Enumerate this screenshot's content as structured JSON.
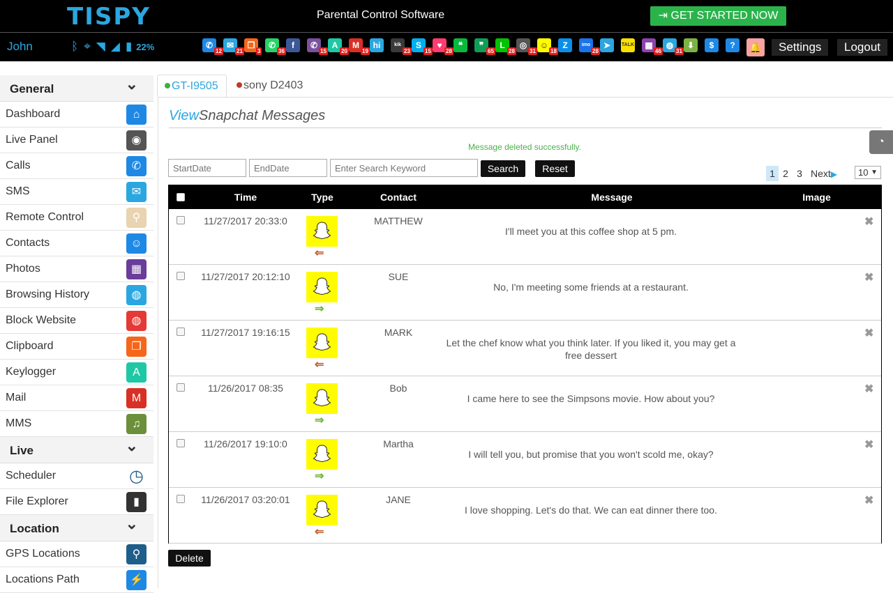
{
  "header": {
    "logo": "TISPY",
    "tagline": "Parental Control Software",
    "cta": "GET STARTED NOW",
    "cta_icon": "sign-in-icon"
  },
  "subbar": {
    "user": "John",
    "battery": "22%",
    "settings": "Settings",
    "logout": "Logout",
    "apps": [
      {
        "name": "phone",
        "glyph": "✆",
        "color": "#1e88e5",
        "badge": "12"
      },
      {
        "name": "mail",
        "glyph": "✉",
        "color": "#2aa7e0",
        "badge": "21"
      },
      {
        "name": "clipboard",
        "glyph": "❐",
        "color": "#f5661b",
        "badge": "3"
      },
      {
        "name": "whatsapp",
        "glyph": "✆",
        "color": "#25d366",
        "badge": "36"
      },
      {
        "name": "facebook",
        "glyph": "f",
        "color": "#3b5998",
        "badge": ""
      },
      {
        "name": "viber",
        "glyph": "✆",
        "color": "#7b519d",
        "badge": "15"
      },
      {
        "name": "keylogger",
        "glyph": "A",
        "color": "#1ec8a5",
        "badge": "20"
      },
      {
        "name": "gmail",
        "glyph": "M",
        "color": "#d93025",
        "badge": "19"
      },
      {
        "name": "hike",
        "glyph": "hi",
        "color": "#2aa7e0",
        "badge": ""
      },
      {
        "name": "kik",
        "glyph": "kik",
        "color": "#3a3a3a",
        "badge": "23"
      },
      {
        "name": "skype",
        "glyph": "S",
        "color": "#00aff0",
        "badge": "15"
      },
      {
        "name": "tinder",
        "glyph": "♥",
        "color": "#fe3c72",
        "badge": "28"
      },
      {
        "name": "wechat",
        "glyph": "❝",
        "color": "#09b83e",
        "badge": ""
      },
      {
        "name": "hangouts",
        "glyph": "❞",
        "color": "#0f9d58",
        "badge": "65"
      },
      {
        "name": "line",
        "glyph": "L",
        "color": "#00c300",
        "badge": "28"
      },
      {
        "name": "instagram",
        "glyph": "◎",
        "color": "#555555",
        "badge": "31"
      },
      {
        "name": "snapchat",
        "glyph": "☺",
        "color": "#fffc00",
        "badge": "18"
      },
      {
        "name": "zalo",
        "glyph": "Z",
        "color": "#0a8fe8",
        "badge": ""
      },
      {
        "name": "imo",
        "glyph": "imo",
        "color": "#1a73e8",
        "badge": "28"
      },
      {
        "name": "telegram",
        "glyph": "➤",
        "color": "#2ca5e0",
        "badge": ""
      },
      {
        "name": "kakaotalk",
        "glyph": "TALK",
        "color": "#f9e000",
        "badge": ""
      },
      {
        "name": "photos",
        "glyph": "▦",
        "color": "#8e44ad",
        "badge": "46"
      },
      {
        "name": "browser",
        "glyph": "◍",
        "color": "#2aa7e0",
        "badge": "31"
      },
      {
        "name": "download",
        "glyph": "⬇",
        "color": "#7cb342",
        "badge": ""
      },
      {
        "name": "dollar",
        "glyph": "$",
        "color": "#1e88e5",
        "badge": ""
      },
      {
        "name": "help",
        "glyph": "?",
        "color": "#1e88e5",
        "badge": ""
      }
    ]
  },
  "sidebar": {
    "sections": [
      {
        "title": "General",
        "items": [
          {
            "label": "Dashboard",
            "icon": "home-icon",
            "glyph": "⌂",
            "color": "#1e88e5"
          },
          {
            "label": "Live Panel",
            "icon": "camera-icon",
            "glyph": "◉",
            "color": "#555555"
          },
          {
            "label": "Calls",
            "icon": "phone-icon",
            "glyph": "✆",
            "color": "#1e88e5"
          },
          {
            "label": "SMS",
            "icon": "envelope-icon",
            "glyph": "✉",
            "color": "#2aa7e0"
          },
          {
            "label": "Remote Control",
            "icon": "map-pin-icon",
            "glyph": "⚲",
            "color": "#e9d3b0"
          },
          {
            "label": "Contacts",
            "icon": "contacts-icon",
            "glyph": "☺",
            "color": "#1e88e5"
          },
          {
            "label": "Photos",
            "icon": "photo-icon",
            "glyph": "▦",
            "color": "#6a3d9a"
          },
          {
            "label": "Browsing History",
            "icon": "globe-icon",
            "glyph": "◍",
            "color": "#2aa7e0"
          },
          {
            "label": "Block Website",
            "icon": "globe-block-icon",
            "glyph": "◍",
            "color": "#e53935"
          },
          {
            "label": "Clipboard",
            "icon": "clipboard-icon",
            "glyph": "❐",
            "color": "#f5661b"
          },
          {
            "label": "Keylogger",
            "icon": "keylogger-icon",
            "glyph": "A",
            "color": "#1ec8a5"
          },
          {
            "label": "Mail",
            "icon": "gmail-icon",
            "glyph": "M",
            "color": "#d93025"
          },
          {
            "label": "MMS",
            "icon": "mms-icon",
            "glyph": "♫",
            "color": "#6d8f3a"
          }
        ]
      },
      {
        "title": "Live",
        "items": [
          {
            "label": "Scheduler",
            "icon": "clock-icon",
            "glyph": "◷",
            "color": "#1e5e8a"
          },
          {
            "label": "File Explorer",
            "icon": "sdcard-icon",
            "glyph": "▮",
            "color": "#333333"
          }
        ]
      },
      {
        "title": "Location",
        "items": [
          {
            "label": "GPS Locations",
            "icon": "gps-pin-icon",
            "glyph": "⚲",
            "color": "#1e5e8a"
          },
          {
            "label": "Locations Path",
            "icon": "path-icon",
            "glyph": "⚡",
            "color": "#1e88e5"
          }
        ]
      }
    ]
  },
  "devices": [
    {
      "name": "GT-I9505",
      "status_color": "#3cb043"
    },
    {
      "name": "sony D2403",
      "status_color": "#c0392b"
    }
  ],
  "page": {
    "title_prefix": "View",
    "title_rest": "Snapchat Messages",
    "flash": "Message deleted successfully."
  },
  "filters": {
    "start_placeholder": "StartDate",
    "end_placeholder": "EndDate",
    "keyword_placeholder": "Enter Search Keyword",
    "search": "Search",
    "reset": "Reset"
  },
  "pagination": {
    "pages": [
      "1",
      "2",
      "3"
    ],
    "current": "1",
    "next": "Next",
    "per_page": "10"
  },
  "table": {
    "columns": {
      "time": "Time",
      "type": "Type",
      "contact": "Contact",
      "message": "Message",
      "image": "Image"
    },
    "rows": [
      {
        "time": "11/27/2017 20:33:0",
        "direction": "incoming",
        "contact": "MATTHEW",
        "message": "I'll meet you at this coffee shop at 5 pm."
      },
      {
        "time": "11/27/2017 20:12:10",
        "direction": "outgoing",
        "contact": "SUE",
        "message": "No, I'm meeting some friends at a restaurant."
      },
      {
        "time": "11/27/2017 19:16:15",
        "direction": "incoming",
        "contact": "MARK",
        "message": "Let the chef know what you think later. If you liked it, you may get a free dessert"
      },
      {
        "time": "11/26/2017 08:35",
        "direction": "outgoing",
        "contact": "Bob",
        "message": "I came here to see the Simpsons movie. How about you?"
      },
      {
        "time": "11/26/2017 19:10:0",
        "direction": "outgoing",
        "contact": "Martha",
        "message": "I will tell you, but promise that you won't scold me, okay?"
      },
      {
        "time": "11/26/2017 03:20:01",
        "direction": "incoming",
        "contact": "JANE",
        "message": "I love shopping. Let's do that. We can eat dinner there too."
      }
    ],
    "delete_button": "Delete"
  },
  "colors": {
    "brand_blue": "#2aa7e0",
    "cta_green": "#2bb34b",
    "snapchat_yellow": "#fffc00",
    "incoming_arrow": "#c0602a",
    "outgoing_arrow": "#6ab42d"
  }
}
